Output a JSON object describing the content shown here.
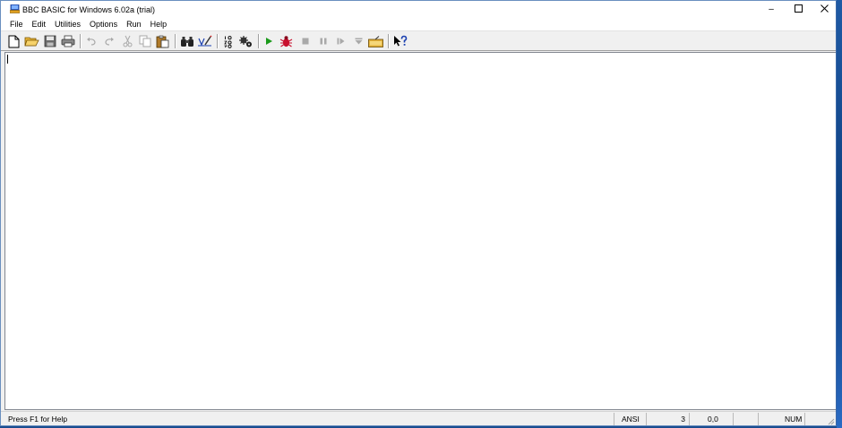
{
  "window": {
    "title": "BBC BASIC for Windows 6.02a (trial)",
    "minimize_glyph": "–",
    "maximize_glyph": "☐",
    "close_glyph": "✕"
  },
  "menu": [
    {
      "label": "File"
    },
    {
      "label": "Edit"
    },
    {
      "label": "Utilities"
    },
    {
      "label": "Options"
    },
    {
      "label": "Run"
    },
    {
      "label": "Help"
    }
  ],
  "toolbar": {
    "buttons": [
      {
        "icon": "new-file-icon"
      },
      {
        "icon": "open-folder-icon"
      },
      {
        "icon": "save-icon"
      },
      {
        "icon": "print-icon"
      },
      {
        "icon": "undo-icon",
        "disabled": true
      },
      {
        "icon": "redo-icon",
        "disabled": true
      },
      {
        "icon": "cut-icon",
        "disabled": true
      },
      {
        "icon": "copy-icon",
        "disabled": true
      },
      {
        "icon": "paste-icon"
      },
      {
        "icon": "find-binoculars-icon"
      },
      {
        "icon": "replace-icon"
      },
      {
        "icon": "renumber-icon"
      },
      {
        "icon": "compile-gears-icon"
      },
      {
        "icon": "run-icon"
      },
      {
        "icon": "debug-bug-icon"
      },
      {
        "icon": "stop-icon",
        "disabled": true
      },
      {
        "icon": "pause-icon",
        "disabled": true
      },
      {
        "icon": "step-icon",
        "disabled": true
      },
      {
        "icon": "step-line-icon",
        "disabled": true
      },
      {
        "icon": "immediate-mode-icon"
      },
      {
        "icon": "context-help-icon"
      }
    ]
  },
  "status": {
    "help": "Press F1 for Help",
    "encoding": "ANSI",
    "lines": "3",
    "position": "0,0",
    "num": "NUM"
  },
  "colors": {
    "run_green": "#1a9a1a",
    "bug_red": "#c8102e",
    "disabled_gray": "#a9a9a9",
    "help_blue": "#1a3fb0"
  }
}
